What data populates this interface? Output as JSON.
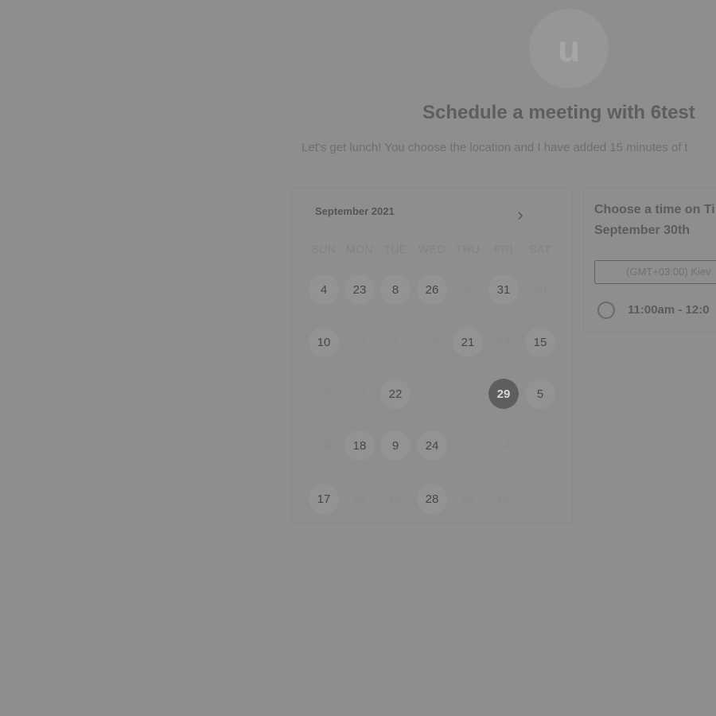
{
  "header": {
    "avatar_letter": "u",
    "title": "Schedule a meeting with 6test",
    "description": "Let's get lunch! You choose the location and I have added 15 minutes of t"
  },
  "calendar": {
    "month_label": "September 2021",
    "prev_icon": "chevron-left-icon",
    "next_icon": "chevron-right-icon",
    "weekdays": [
      "SUN",
      "MON",
      "TUE",
      "WED",
      "THU",
      "FRI",
      "SAT"
    ],
    "weeks": [
      [
        {
          "label": "4",
          "state": "available"
        },
        {
          "label": "23",
          "state": "available"
        },
        {
          "label": "8",
          "state": "available"
        },
        {
          "label": "26",
          "state": "available"
        },
        {
          "label": "20",
          "state": "disabled"
        },
        {
          "label": "31",
          "state": "available"
        },
        {
          "label": "30",
          "state": "disabled"
        }
      ],
      [
        {
          "label": "10",
          "state": "available"
        },
        {
          "label": "14",
          "state": "disabled"
        },
        {
          "label": "1",
          "state": "disabled"
        },
        {
          "label": "12",
          "state": "disabled"
        },
        {
          "label": "21",
          "state": "available"
        },
        {
          "label": "23",
          "state": "disabled"
        },
        {
          "label": "15",
          "state": "available"
        }
      ],
      [
        {
          "label": "26",
          "state": "disabled"
        },
        {
          "label": "27",
          "state": "disabled"
        },
        {
          "label": "22",
          "state": "available"
        },
        {
          "label": "17",
          "state": "disabled"
        },
        {
          "label": "19",
          "state": "disabled"
        },
        {
          "label": "29",
          "state": "selected"
        },
        {
          "label": "5",
          "state": "available"
        }
      ],
      [
        {
          "label": "29",
          "state": "disabled"
        },
        {
          "label": "18",
          "state": "available"
        },
        {
          "label": "9",
          "state": "available"
        },
        {
          "label": "24",
          "state": "available"
        },
        {
          "label": "2",
          "state": "disabled"
        },
        {
          "label": "24",
          "state": "disabled"
        },
        {
          "label": "17",
          "state": "disabled"
        }
      ],
      [
        {
          "label": "17",
          "state": "available"
        },
        {
          "label": "28",
          "state": "disabled"
        },
        {
          "label": "16",
          "state": "disabled"
        },
        {
          "label": "28",
          "state": "available"
        },
        {
          "label": "28",
          "state": "disabled"
        },
        {
          "label": "19",
          "state": "disabled"
        },
        {
          "label": "7",
          "state": "disabled"
        }
      ]
    ]
  },
  "times": {
    "heading_line1": "Choose a time on Ti",
    "heading_line2": "September 30th",
    "timezone": "(GMT+03:00) Kiev",
    "slots": [
      {
        "label": "11:00am - 12:0"
      }
    ]
  },
  "colors": {
    "overlay": "#8e8e8e",
    "selected_day": "#5e5e5e"
  }
}
